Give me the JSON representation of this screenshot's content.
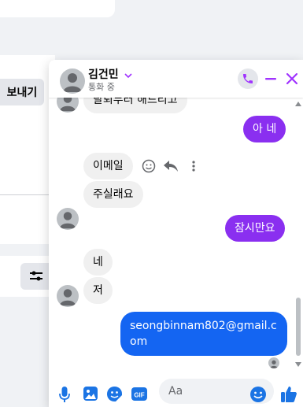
{
  "background": {
    "send_button_label": "보내기"
  },
  "chat": {
    "contact_name": "김건민",
    "contact_status": "통화 중",
    "accent_color": "#a033ff",
    "messages": [
      {
        "side": "in",
        "text": "탈퇴부터 해드리고"
      },
      {
        "side": "out",
        "text": "아 네"
      },
      {
        "side": "in",
        "text": "이메일"
      },
      {
        "side": "in",
        "text": "주실래요"
      },
      {
        "side": "out",
        "text": "잠시만요"
      },
      {
        "side": "in",
        "text": "네"
      },
      {
        "side": "in",
        "text": "저"
      },
      {
        "side": "out",
        "text": "seongbinnam802@gmail.com"
      }
    ],
    "composer": {
      "placeholder": "Aa",
      "icons": [
        "microphone-icon",
        "image-icon",
        "sticker-icon",
        "gif-icon",
        "emoji-icon",
        "thumbs-up-icon"
      ]
    },
    "message_actions": [
      "react-icon",
      "reply-icon",
      "more-icon"
    ]
  }
}
